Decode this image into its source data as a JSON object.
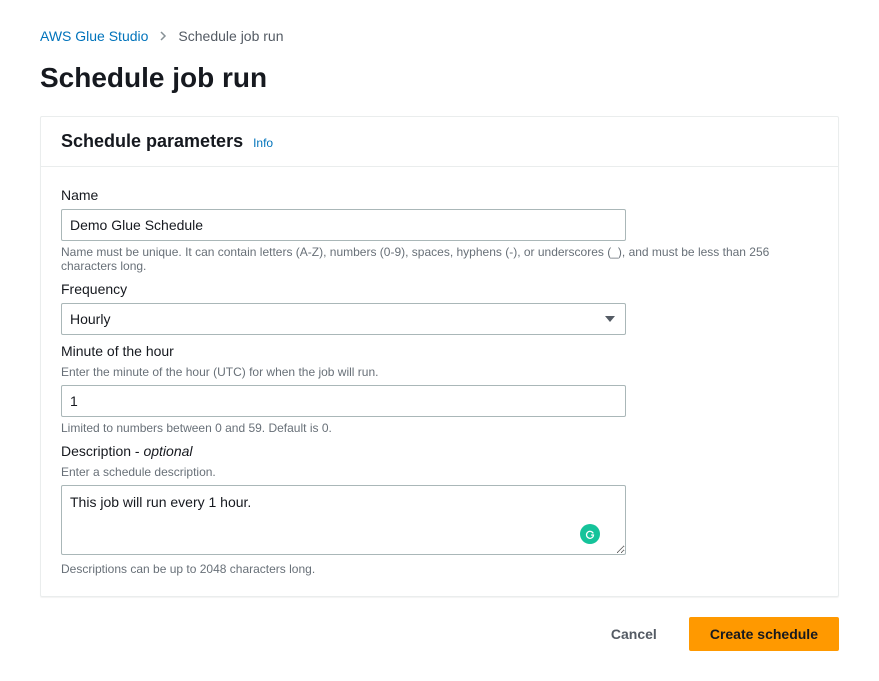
{
  "breadcrumb": {
    "root": "AWS Glue Studio",
    "current": "Schedule job run"
  },
  "pageTitle": "Schedule job run",
  "panel": {
    "title": "Schedule parameters",
    "info": "Info"
  },
  "fields": {
    "name": {
      "label": "Name",
      "value": "Demo Glue Schedule",
      "hint": "Name must be unique. It can contain letters (A-Z), numbers (0-9), spaces, hyphens (-), or underscores (_), and must be less than 256 characters long."
    },
    "frequency": {
      "label": "Frequency",
      "value": "Hourly"
    },
    "minute": {
      "label": "Minute of the hour",
      "sublabel": "Enter the minute of the hour (UTC) for when the job will run.",
      "value": "1",
      "hint": "Limited to numbers between 0 and 59. Default is 0."
    },
    "description": {
      "label": "Description - ",
      "optional": "optional",
      "sublabel": "Enter a schedule description.",
      "value": "This job will run every 1 hour.",
      "hint": "Descriptions can be up to 2048 characters long."
    }
  },
  "actions": {
    "cancel": "Cancel",
    "create": "Create schedule"
  }
}
